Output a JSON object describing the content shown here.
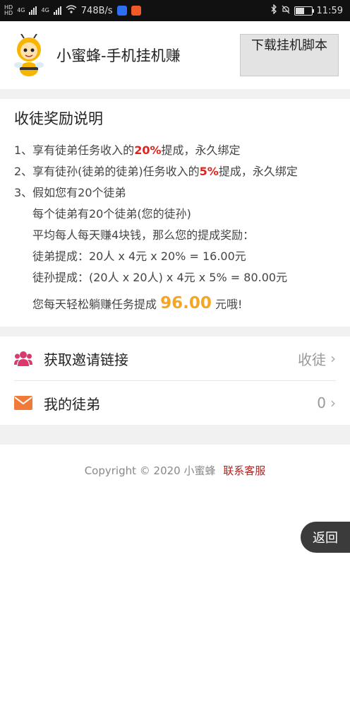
{
  "status_bar": {
    "left_badges": [
      "HD",
      "HD"
    ],
    "net1": "4G",
    "net2": "4G",
    "speed": "748B/s",
    "time": "11:59"
  },
  "header": {
    "title": "小蜜蜂-手机挂机赚",
    "download_btn": "下载挂机脚本"
  },
  "reward": {
    "title": "收徒奖励说明",
    "l1_pre": "1、享有徒弟任务收入的",
    "l1_pct": "20%",
    "l1_post": "提成，永久绑定",
    "l2_pre": "2、享有徒孙(徒弟的徒弟)任务收入的",
    "l2_pct": "5%",
    "l2_post": "提成，永久绑定",
    "l3": "3、假如您有20个徒弟",
    "l4": "每个徒弟有20个徒弟(您的徒孙)",
    "l5": "平均每人每天赚4块钱，那么您的提成奖励：",
    "l6": "徒弟提成：20人 x 4元 x 20% = 16.00元",
    "l7": "徒孙提成：(20人 x 20人) x 4元 x 5% = 80.00元",
    "l8_pre": "您每天轻松躺赚任务提成 ",
    "l8_amount": "96.00",
    "l8_post": " 元哦!"
  },
  "menu": {
    "invite_label": "获取邀请链接",
    "invite_value": "收徒",
    "disciples_label": "我的徒弟",
    "disciples_value": "0"
  },
  "footer": {
    "copyright": "Copyright © 2020 小蜜蜂",
    "contact": "联系客服"
  },
  "back_btn": "返回",
  "colors": {
    "accent_red": "#e0231b",
    "amount_orange": "#f5a623",
    "invite_icon": "#d63b6c",
    "mail_icon": "#f07a3a"
  },
  "icons": {
    "invite": "group-icon",
    "disciples": "mail-icon",
    "chevron": "chevron-right-icon"
  }
}
